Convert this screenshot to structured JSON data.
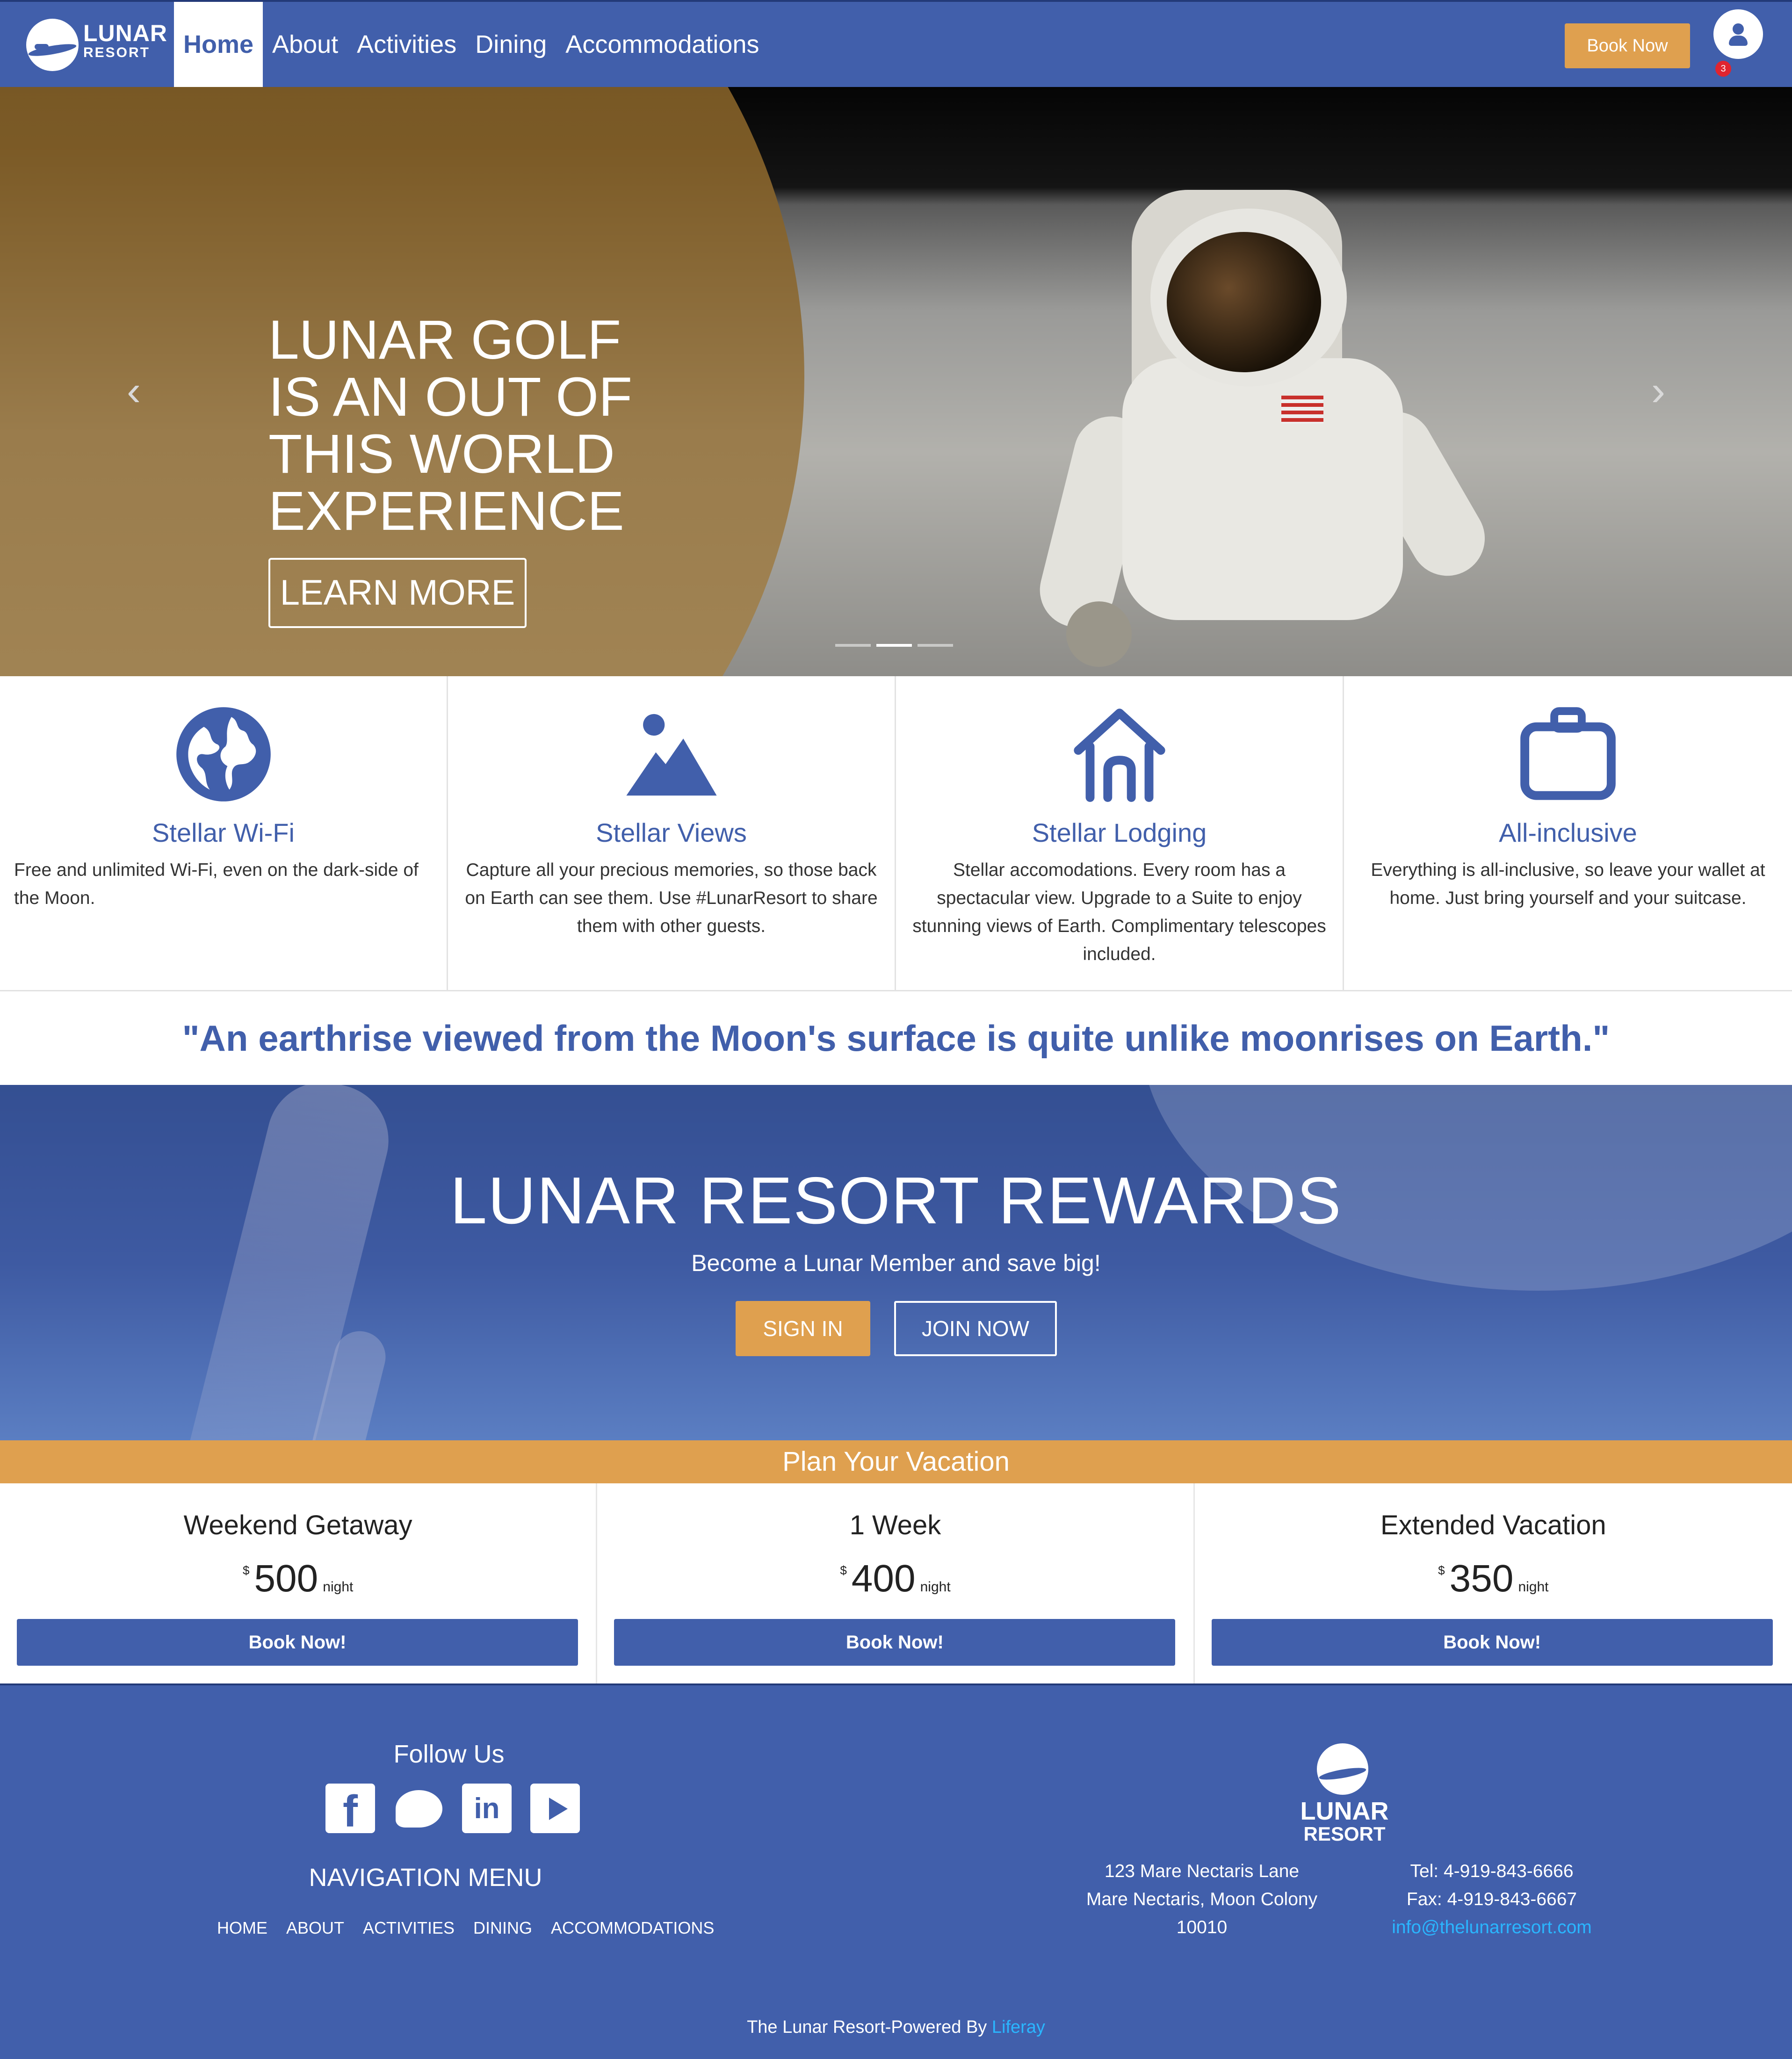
{
  "header": {
    "logo_line1": "LUNAR",
    "logo_line2": "RESORT",
    "nav": [
      "Home",
      "About",
      "Activities",
      "Dining",
      "Accommodations"
    ],
    "active_nav": "Home",
    "book_label": "Book Now",
    "notification_count": "3"
  },
  "hero": {
    "title_lines": [
      "LUNAR GOLF",
      "IS AN OUT OF",
      "THIS WORLD",
      "EXPERIENCE"
    ],
    "cta_label": "LEARN MORE",
    "prev_glyph": "‹",
    "next_glyph": "›",
    "slide_count": 3,
    "active_slide": 2
  },
  "features": [
    {
      "icon": "globe-icon",
      "title": "Stellar Wi-Fi",
      "desc": "Free and unlimited Wi-Fi, even on the dark-side of the Moon."
    },
    {
      "icon": "mountain-image-icon",
      "title": "Stellar Views",
      "desc": "Capture all your precious memories, so those back on Earth can see them. Use #LunarResort to share them with other guests."
    },
    {
      "icon": "house-icon",
      "title": "Stellar Lodging",
      "desc": "Stellar accomodations. Every room has a spectacular view. Upgrade to a Suite to enjoy stunning views of Earth. Complimentary telescopes included."
    },
    {
      "icon": "suitcase-icon",
      "title": "All-inclusive",
      "desc": "Everything is all-inclusive, so leave your wallet at home. Just bring yourself and your suitcase."
    }
  ],
  "quote": "\"An earthrise viewed from the Moon's surface is quite unlike moonrises on Earth.\"",
  "rewards": {
    "title": "LUNAR RESORT REWARDS",
    "subtitle": "Become a Lunar Member and save big!",
    "sign_in": "SIGN IN",
    "join": "JOIN NOW"
  },
  "plan": {
    "title": "Plan Your Vacation",
    "items": [
      {
        "name": "Weekend Getaway",
        "currency": "$",
        "price": "500",
        "unit": "night",
        "button": "Book Now!"
      },
      {
        "name": "1 Week",
        "currency": "$",
        "price": "400",
        "unit": "night",
        "button": "Book Now!"
      },
      {
        "name": "Extended Vacation",
        "currency": "$",
        "price": "350",
        "unit": "night",
        "button": "Book Now!"
      }
    ]
  },
  "footer": {
    "follow": "Follow Us",
    "social": [
      "facebook-icon",
      "twitter-icon",
      "linkedin-icon",
      "youtube-icon"
    ],
    "nav_title": "NAVIGATION MENU",
    "nav_links": [
      "HOME",
      "ABOUT",
      "ACTIVITIES",
      "DINING",
      "ACCOMMODATIONS"
    ],
    "logo_line1": "LUNAR",
    "logo_line2": "RESORT",
    "address": [
      "123 Mare Nectaris Lane",
      "Mare Nectaris, Moon Colony",
      "10010"
    ],
    "tel": "Tel: 4-919-843-6666",
    "fax": "Fax: 4-919-843-6667",
    "email": "info@thelunarresort.com",
    "powered_text": "The Lunar Resort-Powered By",
    "powered_link": "Liferay"
  },
  "colors": {
    "primary": "#415fab",
    "accent": "#dfa04f",
    "link": "#2ab6ff"
  }
}
